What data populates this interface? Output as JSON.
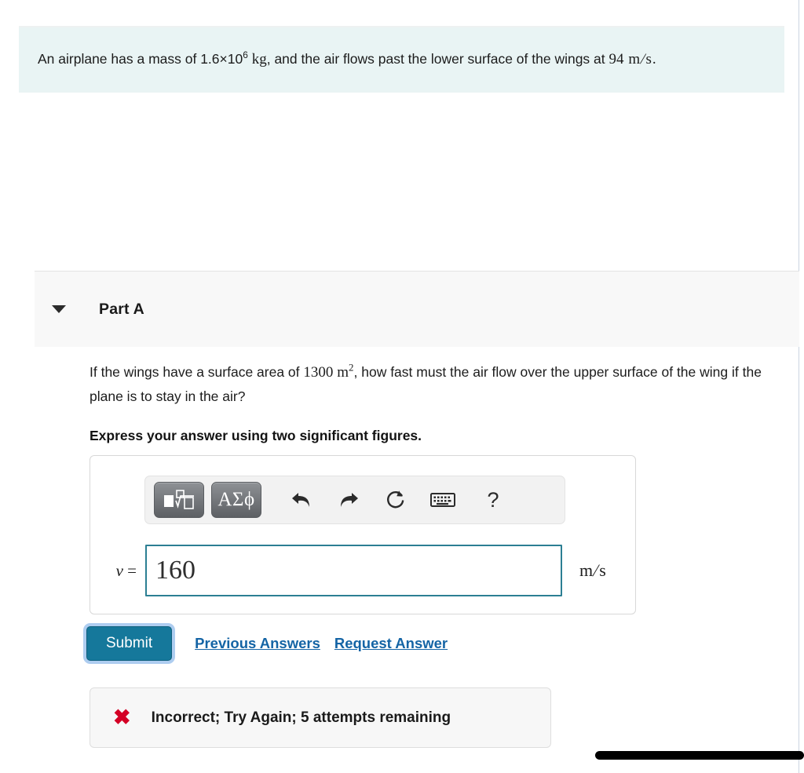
{
  "problem": {
    "text_before_mass": "An airplane has a mass of ",
    "mass_mantissa": "1.6×10",
    "mass_exponent": "6",
    "mass_unit": "kg",
    "text_middle": ", and the air flows past the lower surface of the wings at ",
    "speed_value": "94",
    "speed_unit_num": "m",
    "speed_unit_den": "s",
    "text_end": "."
  },
  "part": {
    "title": "Part A",
    "collapse_icon": "triangle-down-icon",
    "question_before_area": "If the wings have a surface area of ",
    "area_value": "1300",
    "area_unit": "m",
    "area_exponent": "2",
    "question_after_area": ", how fast must the air flow over the upper surface of the wing if the plane is to stay in the air?",
    "instruction": "Express your answer using two significant figures."
  },
  "toolbar": {
    "template_button_label": "math-template-palette",
    "greek_button_label": "ΑΣϕ",
    "undo_label": "undo-icon",
    "redo_label": "redo-icon",
    "reset_label": "reset-icon",
    "keyboard_label": "keyboard-icon",
    "help_label": "?"
  },
  "answer": {
    "variable": "v",
    "equals": "=",
    "value": "160",
    "placeholder": "",
    "unit_numerator": "m",
    "unit_denominator": "s",
    "border_color": "#2c7f93"
  },
  "actions": {
    "submit_label": "Submit",
    "previous_answers_label": "Previous Answers",
    "request_answer_label": "Request Answer",
    "submit_color": "#15789b",
    "link_color": "#1464a5"
  },
  "feedback": {
    "icon": "x-mark-icon",
    "icon_glyph": "✖",
    "message": "Incorrect; Try Again; 5 attempts remaining",
    "icon_color": "#d40025"
  }
}
